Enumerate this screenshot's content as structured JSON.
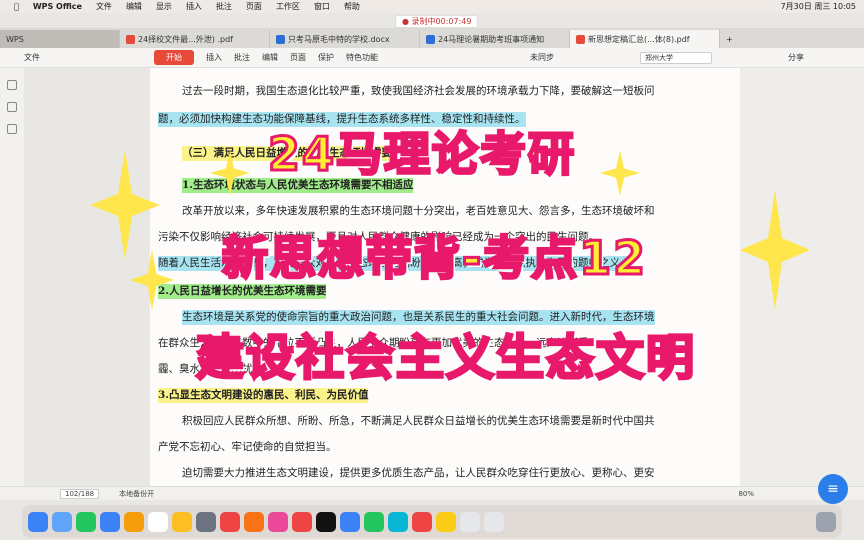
{
  "menubar": {
    "app": "WPS Office",
    "items": [
      "文件",
      "编辑",
      "显示",
      "插入",
      "批注",
      "页面",
      "工作区",
      "窗口",
      "帮助"
    ],
    "clock": "7月30日 周三 10:05"
  },
  "recording": "录制中00:07:49",
  "tabs": [
    "WPS",
    "24择校文件最...外泄) .pdf",
    "只考马原毛中特的学校.docx",
    "24马理论暑期助考班事项通知",
    "新思想定稿汇总(...体(8).pdf"
  ],
  "toolbar": {
    "file": "文件",
    "start": "开始",
    "items": [
      "插入",
      "批注",
      "编辑",
      "页面",
      "保护",
      "特色功能"
    ],
    "sync": "未同步",
    "search": "郑州大学",
    "share": "分享"
  },
  "doc_lines": [
    "过去一段时期，我国生态退化比较严重，致使我国经济社会发展的环境承载力下降，要破解这一短板问",
    "题，必须加快构建生态功能保障基线，提升生态系统多样性、稳定性和持续性。",
    "（三）满足人民日益增长的优美生态环境需要",
    "1.生态环境状态与人民优美生态环境需要不相适应",
    "改革开放以来，多年快速发展积累的生态环境问题十分突出，老百姓意见大、怨言多，生态环境破坏和",
    "污染不仅影响经济社会可持续发展，而且对人民群众健康的影响已经成为一个突出的民生问题。",
    "随着人民生活水平提高，人民群众对优美生态环境的期盼越来越高，成为我们党执政为民的题中之义。",
    "2.人民日益增长的优美生态环境需要",
    "生态环境是关系党的使命宗旨的重大政治问题，也是关系民生的重大社会问题。进入新时代，生态环境",
    "在群众生活幸福指数中的地位不断凸显，人民群众期盼享有更加优美的生态环境，远离浓烟重",
    "霾、臭水垃圾的困扰。",
    "3.凸显生态文明建设的惠民、利民、为民价值",
    "积极回应人民群众所想、所盼、所急，不断满足人民群众日益增长的优美生态环境需要是新时代中国共",
    "产党不忘初心、牢记使命的自觉担当。",
    "迫切需要大力推进生态文明建设，提供更多优质生态产品，让人民群众吃穿住行更放心、更称心、更安"
  ],
  "overlay": {
    "line1": "24马理论考研",
    "line2": "新思想带背-考点12",
    "line3": "建设社会主义生态文明"
  },
  "status": {
    "page": "102",
    "total": "188",
    "backup": "本地备份开",
    "zoom": "80%"
  }
}
